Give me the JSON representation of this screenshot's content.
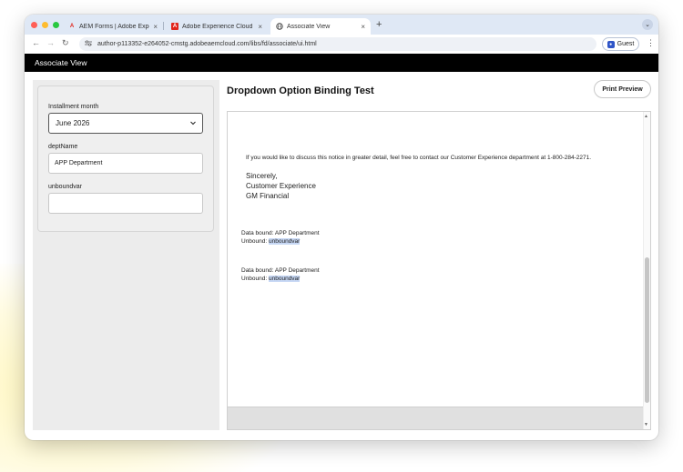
{
  "browser": {
    "tabs": [
      {
        "title": "AEM Forms | Adobe Experien",
        "icon": "adobe-icon"
      },
      {
        "title": "Adobe Experience Cloud",
        "icon": "adobe-icon"
      },
      {
        "title": "Associate View",
        "icon": "globe-icon"
      }
    ],
    "close_glyph": "×",
    "new_tab_glyph": "+",
    "tab_menu_glyph": "⌄",
    "url": "author-p113352-e264052-cmstg.adobeaemcloud.com/libs/fd/associate/ui.html",
    "profile_label": "Guest",
    "back_glyph": "←",
    "forward_glyph": "→",
    "reload_glyph": "↻",
    "menu_glyph": "⋮"
  },
  "app": {
    "header_title": "Associate View"
  },
  "form": {
    "installment_label": "Installment month",
    "installment_value": "June 2026",
    "dept_label": "deptName",
    "dept_value": "APP Department",
    "unbound_label": "unboundvar",
    "unbound_value": ""
  },
  "document": {
    "title": "Dropdown Option Binding Test",
    "print_label": "Print Preview",
    "contact_line": "If you would like to discuss this notice in greater detail, feel free to contact our Customer Experience department at 1-800-284-2271.",
    "closing": "Sincerely,",
    "signer_dept": "Customer Experience",
    "signer_company": "GM Financial",
    "block1_bound_prefix": "Data bound: ",
    "block1_bound_value": "APP Department",
    "block1_unbound_prefix": "Unbound: ",
    "block1_unbound_value": "unboundvar",
    "block2_bound_prefix": "Data bound: ",
    "block2_bound_value": "APP Department",
    "block2_unbound_prefix": "Unbound: ",
    "block2_unbound_value": "unboundvar"
  },
  "colors": {
    "header_bg": "#000000",
    "tabstrip_bg": "#dfe8f5",
    "highlight": "#c7d8f5"
  }
}
